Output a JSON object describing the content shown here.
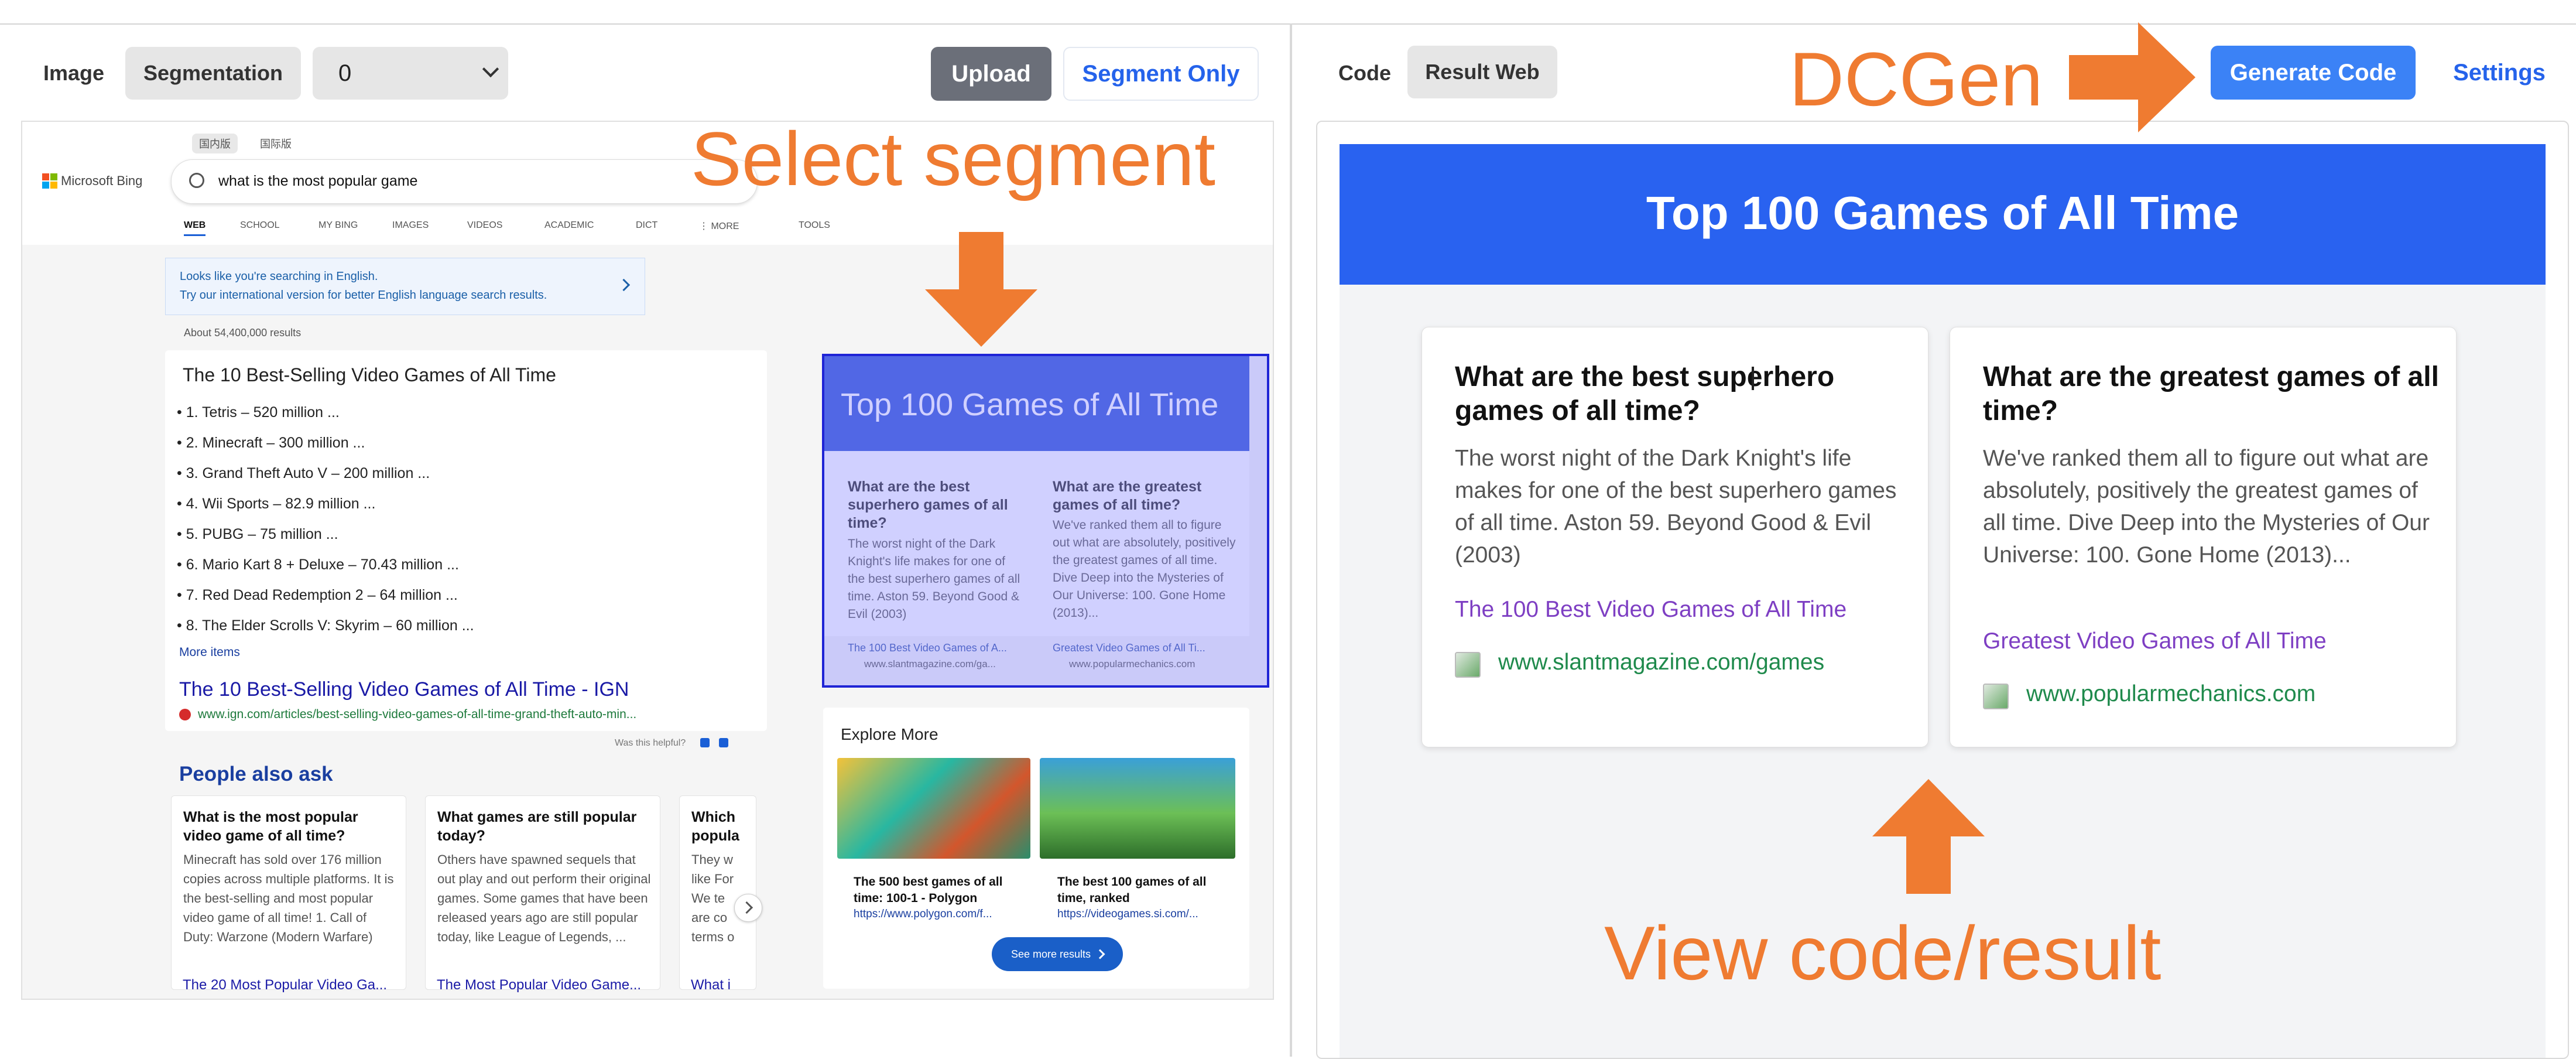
{
  "left_toolbar": {
    "image_label": "Image",
    "segmentation_label": "Segmentation",
    "select_value": "0",
    "upload_label": "Upload",
    "segment_only_label": "Segment Only"
  },
  "right_toolbar": {
    "code_label": "Code",
    "result_web_label": "Result Web",
    "generate_label": "Generate Code",
    "settings_label": "Settings"
  },
  "bing": {
    "logo_text": "Microsoft Bing",
    "region_tabs": [
      "国内版",
      "国际版"
    ],
    "query": "what is the most popular game",
    "nav": [
      "WEB",
      "SCHOOL",
      "MY BING",
      "IMAGES",
      "VIDEOS",
      "ACADEMIC",
      "DICT",
      "⋮ MORE",
      "TOOLS"
    ],
    "notice_line1": "Looks like you're searching in English.",
    "notice_line2": "Try our international version for better English language search results.",
    "result_count": "About 54,400,000 results",
    "list_title": "The 10 Best-Selling Video Games of All Time",
    "list_items": [
      "1. Tetris – 520 million ...",
      "2. Minecraft – 300 million ...",
      "3. Grand Theft Auto V – 200 million ...",
      "4. Wii Sports – 82.9 million ...",
      "5. PUBG – 75 million ...",
      "6. Mario Kart 8 + Deluxe – 70.43 million ...",
      "7. Red Dead Redemption 2 – 64 million ...",
      "8. The Elder Scrolls V: Skyrim – 60 million ..."
    ],
    "more_items": "More items",
    "result_link": "The 10 Best-Selling Video Games of All Time - IGN",
    "result_url": "www.ign.com/articles/best-selling-video-games-of-all-time-grand-theft-auto-min...",
    "helpful": "Was this helpful?",
    "paa_title": "People also ask",
    "paa": [
      {
        "q": "What is the most popular video game of all time?",
        "a": "Minecraft has sold over 176 million copies across multiple platforms. It is the best-selling and most popular video game of all time! 1. Call of Duty: Warzone (Modern Warfare)",
        "link": "The 20 Most Popular Video Ga..."
      },
      {
        "q": "What games are still popular today?",
        "a": "Others have spawned sequels that out play and out perform their original games. Some games that have been released years ago are still popular today, like League of Legends, ...",
        "link": "The Most Popular Video Game..."
      },
      {
        "q": "Which popula",
        "a": "They w like For We te are co terms o",
        "link": "What i"
      }
    ],
    "mini": {
      "title": "Top 100 Games of All Time",
      "c1_h": "What are the best superhero games of all time?",
      "c1_p": "The worst night of the Dark Knight's life makes for one of the best superhero games of all time. Aston 59. Beyond Good & Evil (2003)",
      "c1_l": "The 100 Best Video Games of A...",
      "c1_u": "www.slantmagazine.com/ga...",
      "c2_h": "What are the greatest games of all time?",
      "c2_p": "We've ranked them all to figure out what are absolutely, positively the greatest games of all time. Dive Deep into the Mysteries of Our Universe: 100. Gone Home (2013)...",
      "c2_l": "Greatest Video Games of All Ti...",
      "c2_u": "www.popularmechanics.com"
    },
    "explore": {
      "title": "Explore More",
      "i1_title": "The 500 best games of all time: 100-1 - Polygon",
      "i1_url": "https://www.polygon.com/f...",
      "i2_title": "The best 100 games of all time, ranked",
      "i2_url": "https://videogames.si.com/...",
      "see_more": "See more results"
    }
  },
  "result_page": {
    "title": "Top 100 Games of All Time",
    "card1": {
      "heading": "What are the best superhero games of all time?",
      "text": "The worst night of the Dark Knight's life makes for one of the best superhero games of all time. Aston 59. Beyond Good & Evil (2003)",
      "link": "The 100 Best Video Games of All Time",
      "url": "www.slantmagazine.com/games"
    },
    "card2": {
      "heading": "What are the greatest games of all time?",
      "text": "We've ranked them all to figure out what are absolutely, positively the greatest games of all time. Dive Deep into the Mysteries of Our Universe: 100. Gone Home (2013)...",
      "link": "Greatest Video Games of All Time",
      "url": "www.popularmechanics.com"
    }
  },
  "annotations": {
    "select_segment": "Select segment",
    "dcgen": "DCGen",
    "view_result": "View code/result"
  },
  "colors": {
    "accent_orange": "#ef7b31",
    "blue_button": "#3b82f6",
    "result_header": "#2962f0",
    "segment_overlay": "#c9c9ff",
    "segment_border": "#1f24d6"
  }
}
